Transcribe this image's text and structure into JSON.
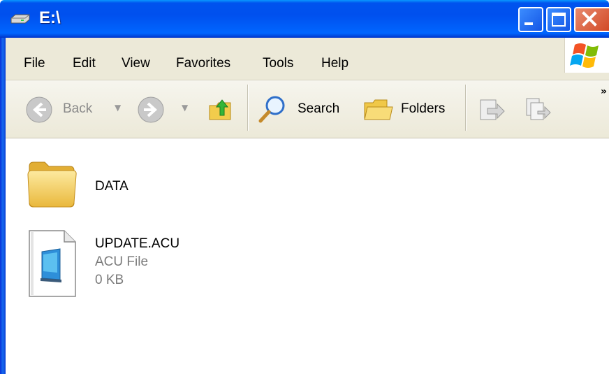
{
  "window": {
    "title": "E:\\"
  },
  "menu": {
    "items": [
      "File",
      "Edit",
      "View",
      "Favorites",
      "Tools",
      "Help"
    ]
  },
  "toolbar": {
    "back_label": "Back",
    "search_label": "Search",
    "folders_label": "Folders",
    "overflow": "»"
  },
  "files": [
    {
      "name": "DATA",
      "type": "folder"
    },
    {
      "name": "UPDATE.ACU",
      "type_label": "ACU File",
      "size": "0 KB"
    }
  ]
}
